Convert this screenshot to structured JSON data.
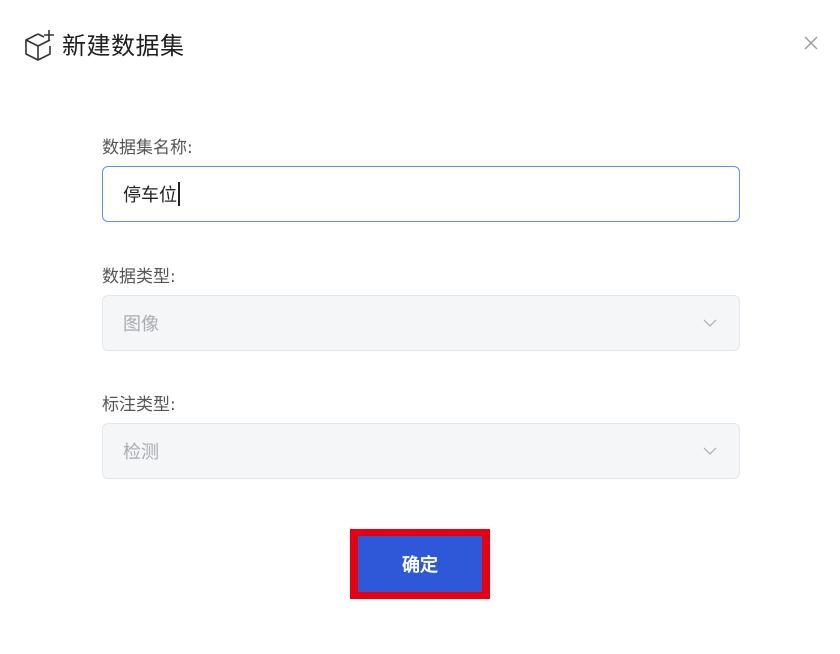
{
  "dialog": {
    "title": "新建数据集",
    "icon": "cube-plus-icon",
    "close_icon": "close-icon"
  },
  "form": {
    "name": {
      "label": "数据集名称:",
      "value": "停车位"
    },
    "data_type": {
      "label": "数据类型:",
      "value": "图像"
    },
    "annotation_type": {
      "label": "标注类型:",
      "value": "检测"
    }
  },
  "actions": {
    "confirm_label": "确定"
  },
  "colors": {
    "primary": "#2d59d9",
    "highlight": "#e60012",
    "input_border": "#5b8ff9",
    "disabled_bg": "#f5f6f8"
  }
}
